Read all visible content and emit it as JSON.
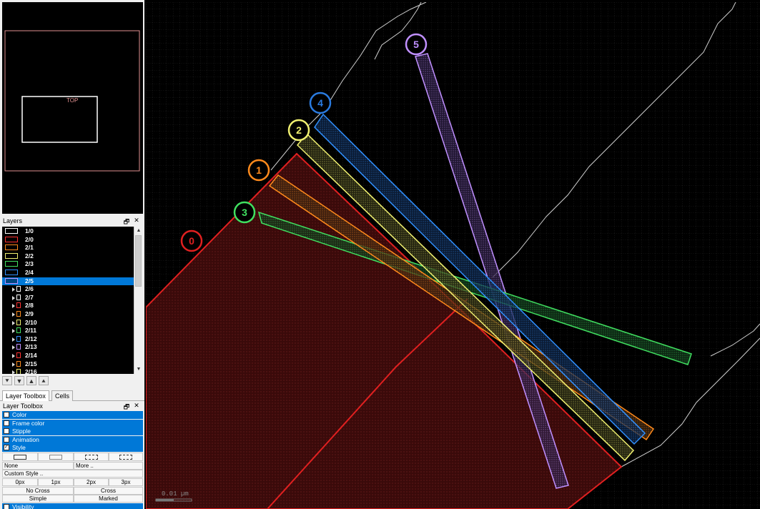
{
  "navigator": {
    "cell_label": "TOP"
  },
  "layers_panel": {
    "title": "Layers",
    "float_icon": "🗗",
    "close_icon": "✕",
    "items": [
      {
        "label": "1/0",
        "color": "#ffffff",
        "sub": false,
        "selected": false
      },
      {
        "label": "2/0",
        "color": "#ff3030",
        "sub": false,
        "selected": false
      },
      {
        "label": "2/1",
        "color": "#ff8a1c",
        "sub": false,
        "selected": false
      },
      {
        "label": "2/2",
        "color": "#f0f070",
        "sub": false,
        "selected": false
      },
      {
        "label": "2/3",
        "color": "#40e060",
        "sub": false,
        "selected": false
      },
      {
        "label": "2/4",
        "color": "#3090ff",
        "sub": false,
        "selected": false
      },
      {
        "label": "2/5",
        "color": "#c090ff",
        "sub": false,
        "selected": true
      },
      {
        "label": "2/6",
        "color": "#ffffff",
        "sub": true,
        "selected": false
      },
      {
        "label": "2/7",
        "color": "#ffffff",
        "sub": true,
        "selected": false
      },
      {
        "label": "2/8",
        "color": "#ff3030",
        "sub": true,
        "selected": false
      },
      {
        "label": "2/9",
        "color": "#ff8a1c",
        "sub": true,
        "selected": false
      },
      {
        "label": "2/10",
        "color": "#f0f070",
        "sub": true,
        "selected": false
      },
      {
        "label": "2/11",
        "color": "#40e060",
        "sub": true,
        "selected": false
      },
      {
        "label": "2/12",
        "color": "#3090ff",
        "sub": true,
        "selected": false
      },
      {
        "label": "2/13",
        "color": "#c090ff",
        "sub": true,
        "selected": false
      },
      {
        "label": "2/14",
        "color": "#ff3030",
        "sub": true,
        "selected": false
      },
      {
        "label": "2/15",
        "color": "#ff8a1c",
        "sub": true,
        "selected": false
      },
      {
        "label": "2/16",
        "color": "#f0f070",
        "sub": true,
        "selected": false
      }
    ]
  },
  "order_buttons": [
    "⯆",
    "▼",
    "▲",
    "⯅"
  ],
  "tabs": {
    "layer_toolbox": "Layer Toolbox",
    "cells": "Cells"
  },
  "toolbox": {
    "title": "Layer Toolbox",
    "sections": [
      {
        "label": "Color",
        "checked": false
      },
      {
        "label": "Frame color",
        "checked": false
      },
      {
        "label": "Stipple",
        "checked": false
      },
      {
        "label": "Animation",
        "checked": false
      },
      {
        "label": "Style",
        "checked": true
      }
    ],
    "none_label": "None",
    "more_label": "More ..",
    "custom_style_label": "Custom Style ..",
    "widths": [
      "0px",
      "1px",
      "2px",
      "3px"
    ],
    "no_cross_label": "No Cross",
    "cross_label": "Cross",
    "simple_label": "Simple",
    "marked_label": "Marked",
    "visibility_label": "Visibility"
  },
  "canvas": {
    "scale_label": "0.01 µm",
    "markers": [
      {
        "label": "0",
        "color": "#e02020"
      },
      {
        "label": "1",
        "color": "#ff8a1c"
      },
      {
        "label": "2",
        "color": "#f0f070"
      },
      {
        "label": "3",
        "color": "#40e060"
      },
      {
        "label": "4",
        "color": "#2a7be0"
      },
      {
        "label": "5",
        "color": "#c090ff"
      }
    ]
  },
  "colors": {
    "selection": "#0078d7",
    "panel_bg": "#f0f0f0",
    "canvas_bg": "#000000"
  }
}
